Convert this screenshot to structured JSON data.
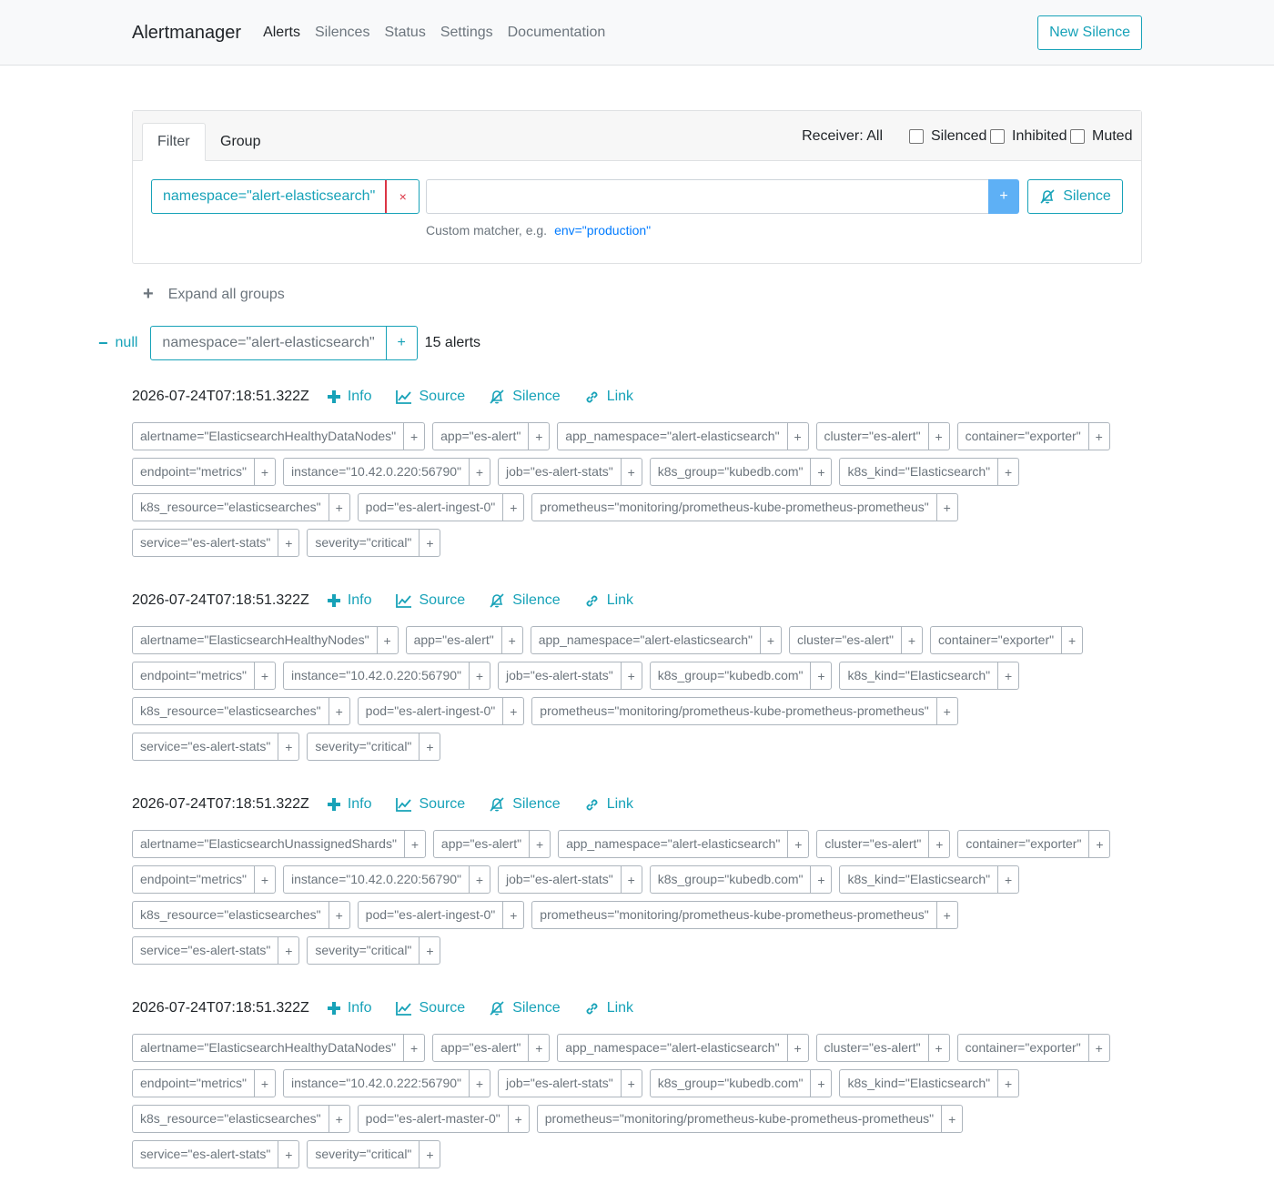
{
  "nav": {
    "brand": "Alertmanager",
    "links": [
      "Alerts",
      "Silences",
      "Status",
      "Settings",
      "Documentation"
    ],
    "new_silence": "New Silence"
  },
  "filter": {
    "tabs": [
      "Filter",
      "Group"
    ],
    "receiver": "Receiver: All",
    "checkboxes": [
      "Silenced",
      "Inhibited",
      "Muted"
    ],
    "matcher": "namespace=\"alert-elasticsearch\"",
    "remove": "×",
    "input_placeholder": "",
    "add": "+",
    "silence": "Silence",
    "hint": "Custom matcher, e.g.",
    "hint_example": "env=\"production\""
  },
  "expand": {
    "icon": "+",
    "label": "Expand all groups"
  },
  "group": {
    "toggle": "−",
    "receiver": "null",
    "matcher": "namespace=\"alert-elasticsearch\"",
    "add": "+",
    "count": "15 alerts"
  },
  "actions": {
    "info": "Info",
    "source": "Source",
    "silence": "Silence",
    "link": "Link"
  },
  "alerts": [
    {
      "timestamp": "2026-07-24T07:18:51.322Z",
      "labels": [
        "alertname=\"ElasticsearchHealthyDataNodes\"",
        "app=\"es-alert\"",
        "app_namespace=\"alert-elasticsearch\"",
        "cluster=\"es-alert\"",
        "container=\"exporter\"",
        "endpoint=\"metrics\"",
        "instance=\"10.42.0.220:56790\"",
        "job=\"es-alert-stats\"",
        "k8s_group=\"kubedb.com\"",
        "k8s_kind=\"Elasticsearch\"",
        "k8s_resource=\"elasticsearches\"",
        "pod=\"es-alert-ingest-0\"",
        "prometheus=\"monitoring/prometheus-kube-prometheus-prometheus\"",
        "service=\"es-alert-stats\"",
        "severity=\"critical\""
      ]
    },
    {
      "timestamp": "2026-07-24T07:18:51.322Z",
      "labels": [
        "alertname=\"ElasticsearchHealthyNodes\"",
        "app=\"es-alert\"",
        "app_namespace=\"alert-elasticsearch\"",
        "cluster=\"es-alert\"",
        "container=\"exporter\"",
        "endpoint=\"metrics\"",
        "instance=\"10.42.0.220:56790\"",
        "job=\"es-alert-stats\"",
        "k8s_group=\"kubedb.com\"",
        "k8s_kind=\"Elasticsearch\"",
        "k8s_resource=\"elasticsearches\"",
        "pod=\"es-alert-ingest-0\"",
        "prometheus=\"monitoring/prometheus-kube-prometheus-prometheus\"",
        "service=\"es-alert-stats\"",
        "severity=\"critical\""
      ]
    },
    {
      "timestamp": "2026-07-24T07:18:51.322Z",
      "labels": [
        "alertname=\"ElasticsearchUnassignedShards\"",
        "app=\"es-alert\"",
        "app_namespace=\"alert-elasticsearch\"",
        "cluster=\"es-alert\"",
        "container=\"exporter\"",
        "endpoint=\"metrics\"",
        "instance=\"10.42.0.220:56790\"",
        "job=\"es-alert-stats\"",
        "k8s_group=\"kubedb.com\"",
        "k8s_kind=\"Elasticsearch\"",
        "k8s_resource=\"elasticsearches\"",
        "pod=\"es-alert-ingest-0\"",
        "prometheus=\"monitoring/prometheus-kube-prometheus-prometheus\"",
        "service=\"es-alert-stats\"",
        "severity=\"critical\""
      ]
    },
    {
      "timestamp": "2026-07-24T07:18:51.322Z",
      "labels": [
        "alertname=\"ElasticsearchHealthyDataNodes\"",
        "app=\"es-alert\"",
        "app_namespace=\"alert-elasticsearch\"",
        "cluster=\"es-alert\"",
        "container=\"exporter\"",
        "endpoint=\"metrics\"",
        "instance=\"10.42.0.222:56790\"",
        "job=\"es-alert-stats\"",
        "k8s_group=\"kubedb.com\"",
        "k8s_kind=\"Elasticsearch\"",
        "k8s_resource=\"elasticsearches\"",
        "pod=\"es-alert-master-0\"",
        "prometheus=\"monitoring/prometheus-kube-prometheus-prometheus\"",
        "service=\"es-alert-stats\"",
        "severity=\"critical\""
      ]
    }
  ],
  "colors": {
    "accent": "#17a2b8",
    "danger": "#dc3545",
    "primary_btn": "#5eb0f5"
  }
}
